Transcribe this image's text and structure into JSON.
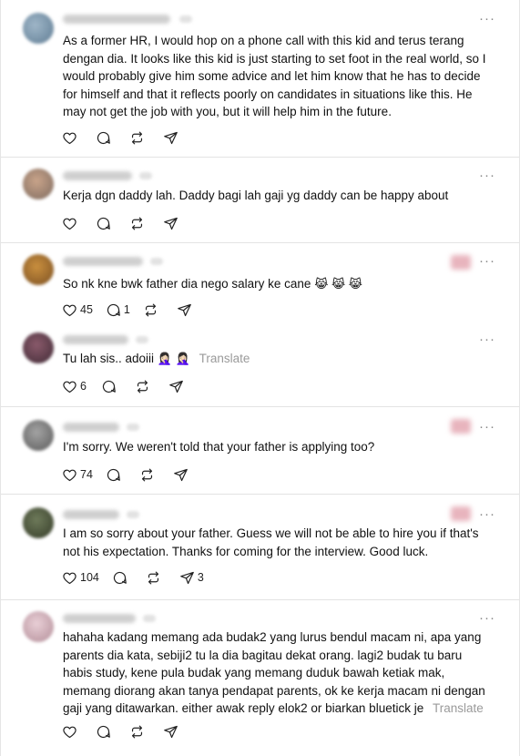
{
  "colors": {
    "background": "#ffffff",
    "text": "#111111",
    "muted": "#9a9a9a",
    "divider": "#e3e3e3"
  },
  "icons": {
    "like": "heart-icon",
    "reply": "comment-icon",
    "repost": "repost-icon",
    "share": "share-icon",
    "menu": "more-icon"
  },
  "posts": [
    {
      "text": "As a former HR, I would hop on a phone call with this kid and terus terang dengan dia. It looks like this kid is just starting to set foot in the real world, so I would probably give him some advice and let him know that he has to decide for himself and that it reflects poorly on candidates in situations like this. He may not get the job with you, but it will help him in the future.",
      "more": "···"
    },
    {
      "text": "Kerja dgn daddy lah. Daddy bagi lah gaji yg daddy can be happy about",
      "more": "···"
    },
    {
      "text": "So nk kne bwk father dia nego salary ke cane",
      "emoji": "😹 😹 😹",
      "likes": "45",
      "replies": "1",
      "more": "···"
    },
    {
      "text": "Tu lah sis.. adoiii",
      "emoji": "🤦🏻‍♀️ 🤦🏻‍♀️",
      "translate": "Translate",
      "likes": "6",
      "more": "···"
    },
    {
      "text": "I'm sorry. We weren't told that your father is applying too?",
      "likes": "74",
      "more": "···"
    },
    {
      "text": "I am so sorry about your father. Guess we will not be able to hire you if that's not his expectation. Thanks for coming for the interview. Good luck.",
      "likes": "104",
      "shares": "3",
      "more": "···"
    },
    {
      "text": "hahaha kadang memang ada budak2 yang lurus bendul macam ni, apa yang parents dia kata, sebiji2 tu la dia bagitau dekat orang. lagi2 budak tu baru habis study, kene pula budak yang memang duduk bawah ketiak mak, memang diorang akan tanya pendapat parents, ok ke kerja macam ni dengan gaji yang ditawarkan. either awak reply elok2 or biarkan bluetick je",
      "translate": "Translate",
      "more": "···"
    }
  ]
}
